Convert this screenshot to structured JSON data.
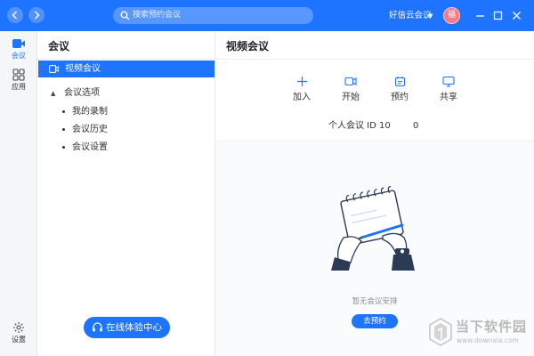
{
  "titlebar": {
    "back_icon": "chevron-left-icon",
    "forward_icon": "chevron-right-icon",
    "search_placeholder": "搜索预约会议",
    "account_name": "好信云会议",
    "avatar_text": "福",
    "brand_color": "#1f74ff"
  },
  "rail": {
    "items": [
      {
        "label": "会议",
        "icon": "video-camera-icon"
      },
      {
        "label": "应用",
        "icon": "grid-apps-icon"
      },
      {
        "label": "设置",
        "icon": "gear-icon"
      }
    ]
  },
  "sidebar": {
    "title": "会议",
    "active_item": "视频会议",
    "group_label": "会议选项",
    "sub_items": [
      "我的录制",
      "会议历史",
      "会议设置"
    ],
    "experience_button": "在线体验中心"
  },
  "main": {
    "title": "视频会议",
    "actions": [
      {
        "label": "加入",
        "icon": "plus-icon"
      },
      {
        "label": "开始",
        "icon": "camera-icon"
      },
      {
        "label": "预约",
        "icon": "calendar-icon"
      },
      {
        "label": "共享",
        "icon": "screen-share-icon"
      }
    ],
    "personal_meeting_id": "个人会议 ID 10",
    "personal_meeting_id_tail": "0",
    "empty_text": "暂无会议安排",
    "schedule_button": "去预约"
  },
  "watermark": {
    "name": "当下软件园",
    "url": "www.downxia.com"
  }
}
